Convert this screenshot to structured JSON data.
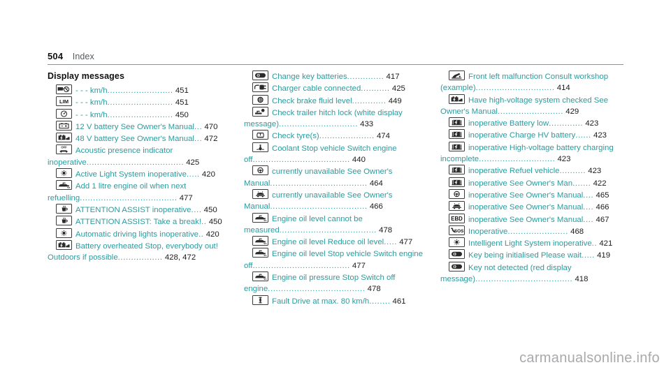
{
  "header": {
    "folio": "504",
    "section": "Index"
  },
  "watermark": "carmanualsonline.info",
  "colors": {
    "entry_teal": "#2e9a9d",
    "page_number": "#1b1b1b",
    "rule": "#8f9294",
    "watermark": "#a9a9ad"
  },
  "columns": [
    {
      "title": "Display messages",
      "entries": [
        {
          "icon": "speed-limit-assist-icon",
          "text": "- - - km/h",
          "page": "451"
        },
        {
          "icon": "lim-icon",
          "text": "- - - km/h",
          "page": "451"
        },
        {
          "icon": "cruise-control-icon",
          "text": "- - - km/h",
          "page": "450"
        },
        {
          "icon": "battery-12v-icon",
          "text": "12 V battery See Owner's Manual",
          "page": "470"
        },
        {
          "icon": "battery-48v-icon",
          "text": "48 V battery See Owner's Manual",
          "page": "472"
        },
        {
          "icon": "acoustic-presence-icon",
          "text": "Acoustic presence indicator inoperative",
          "page": "425"
        },
        {
          "icon": "headlamp-icon",
          "text": "Active Light System inoperative",
          "page": "420"
        },
        {
          "icon": "engine-oil-icon",
          "text": "Add 1 litre engine oil when next refuelling",
          "page": "477"
        },
        {
          "icon": "attention-assist-icon",
          "text": "ATTENTION ASSIST inoperative",
          "page": "450"
        },
        {
          "icon": "attention-assist-icon",
          "text": "ATTENTION ASSIST: Take a break!",
          "page": "450"
        },
        {
          "icon": "headlamp-icon",
          "text": "Automatic driving lights inoperative",
          "page": "420"
        },
        {
          "icon": "battery-48v-icon",
          "text": "Battery overheated Stop, everybody out! Outdoors if possible",
          "page": "428, 472"
        }
      ]
    },
    {
      "title": "",
      "entries": [
        {
          "icon": "key-icon",
          "text": "Change key batteries",
          "page": "417"
        },
        {
          "icon": "charger-cable-icon",
          "text": "Charger cable connected",
          "page": "425"
        },
        {
          "icon": "brake-fluid-icon",
          "text": "Check brake fluid level",
          "page": "449"
        },
        {
          "icon": "trailer-hitch-icon",
          "text": "Check trailer hitch lock  (white display message)",
          "page": "433"
        },
        {
          "icon": "tyre-pressure-icon",
          "text": "Check tyre(s)",
          "page": "474"
        },
        {
          "icon": "coolant-icon",
          "text": "Coolant Stop vehicle Switch engine off",
          "page": "440"
        },
        {
          "icon": "steering-icon",
          "text": "currently unavailable See Owner's Manual",
          "page": "464"
        },
        {
          "icon": "suspension-icon",
          "text": "currently unavailable See Owner's Manual",
          "page": "466"
        },
        {
          "icon": "engine-oil-icon",
          "text": "Engine oil level cannot be measured",
          "page": "478"
        },
        {
          "icon": "engine-oil-icon",
          "text": "Engine oil level Reduce oil level",
          "page": "477"
        },
        {
          "icon": "engine-oil-icon",
          "text": "Engine oil level Stop vehicle Switch engine off",
          "page": "477"
        },
        {
          "icon": "engine-oil-icon",
          "text": "Engine oil pressure Stop Switch off engine",
          "page": "478"
        },
        {
          "icon": "shock-absorber-icon",
          "text": "Fault Drive at max. 80 km/h",
          "page": "461"
        }
      ]
    },
    {
      "title": "",
      "entries": [
        {
          "icon": "front-malfunction-icon",
          "text": "Front left malfunction Consult workshop (example)",
          "page": "414"
        },
        {
          "icon": "battery-48v-icon",
          "text": "Have high-voltage system checked See Owner's Manual",
          "page": "429"
        },
        {
          "icon": "hv-battery-icon",
          "text": "inoperative Battery low",
          "page": "423"
        },
        {
          "icon": "hv-battery-icon",
          "text": "inoperative Charge HV battery",
          "page": "423"
        },
        {
          "icon": "hv-battery-icon",
          "text": "inoperative High-voltage battery charging incomplete",
          "page": "423"
        },
        {
          "icon": "hv-battery-icon",
          "text": "inoperative Refuel vehicle",
          "page": "423"
        },
        {
          "icon": "hv-battery-icon",
          "text": "inoperative See Owner's Man",
          "page": "422"
        },
        {
          "icon": "steering-icon",
          "text": "inoperative See Owner's Manual",
          "page": "465"
        },
        {
          "icon": "suspension-icon",
          "text": "inoperative See Owner's Manual",
          "page": "466"
        },
        {
          "icon": "ebd-icon",
          "text": "inoperative See Owner's Manual",
          "page": "467"
        },
        {
          "icon": "sos-icon",
          "text": "Inoperative",
          "page": "468"
        },
        {
          "icon": "headlamp-icon",
          "text": "Intelligent Light System inoperative",
          "page": "421"
        },
        {
          "icon": "key-icon",
          "text": "Key being initialised Please wait",
          "page": "419"
        },
        {
          "icon": "key-icon",
          "text": "Key not detected  (red display message)",
          "page": "418"
        }
      ]
    }
  ]
}
